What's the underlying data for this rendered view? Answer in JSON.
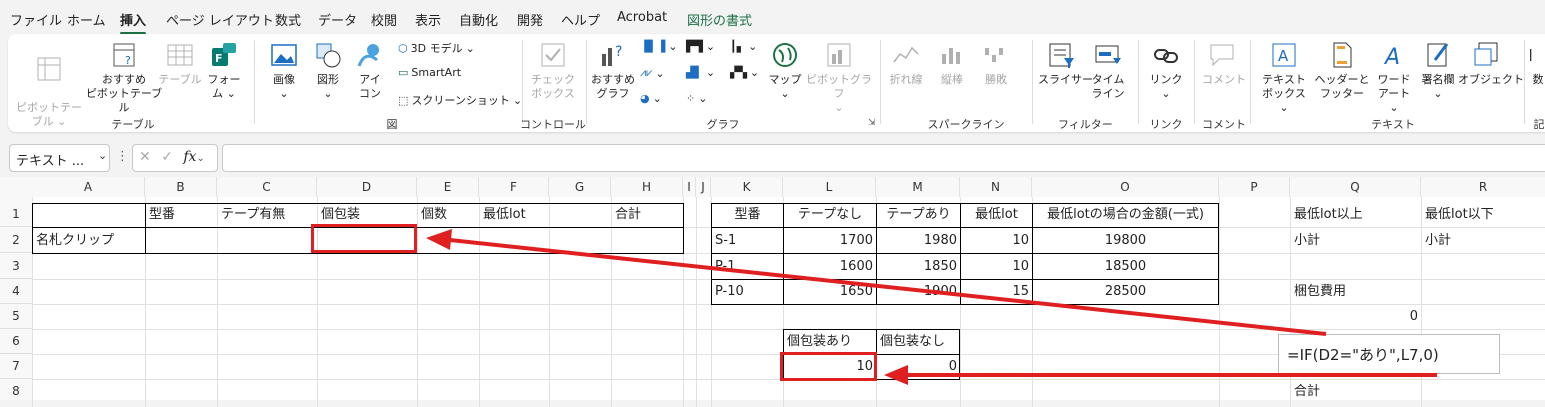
{
  "menu": [
    "ファイル",
    "ホーム",
    "挿入",
    "ページ レイアウト",
    "数式",
    "データ",
    "校閲",
    "表示",
    "自動化",
    "開発",
    "ヘルプ",
    "Acrobat",
    "図形の書式"
  ],
  "ribbon": {
    "pivot_table": "ピボットテー\nブル ⌄",
    "recommended_pivot": "おすすめ\nピボットテーブル",
    "table": "テーブル",
    "forms": "フォー\nム ⌄",
    "group_table": "テーブル",
    "image": "画像\n⌄",
    "shapes": "図形\n⌄",
    "icons": "アイ\nコン",
    "model3d": "3D モデル",
    "smartart": "SmartArt",
    "screenshot": "スクリーンショット",
    "group_figure": "図",
    "checkbox": "チェック\nボックス",
    "group_control": "コントロール",
    "recommended_chart": "おすすめ\nグラフ",
    "map": "マップ\n⌄",
    "pivot_chart": "ピボットグラフ\n⌄",
    "group_chart": "グラフ",
    "line": "折れ線",
    "column": "縦棒",
    "winloss": "勝敗",
    "group_sparkline": "スパークライン",
    "slicer": "スライサー",
    "timeline": "タイム\nライン",
    "group_filter": "フィルター",
    "link": "リンク\n⌄",
    "group_link": "リンク",
    "comment": "コメント",
    "group_comment": "コメント",
    "textbox": "テキスト\nボックス ⌄",
    "header_footer": "ヘッダーと\nフッター",
    "wordart": "ワード\nアート ⌄",
    "signature": "署名欄\n⌄",
    "object": "オブジェクト",
    "group_text": "テキスト",
    "symbol": "数",
    "group_symbol": "記"
  },
  "formula_bar": {
    "name_box": "テキスト ...",
    "fx": "fx",
    "formula": ""
  },
  "columns": [
    "A",
    "B",
    "C",
    "D",
    "E",
    "F",
    "G",
    "H",
    "I",
    "J",
    "K",
    "L",
    "M",
    "N",
    "O",
    "P",
    "Q",
    "R"
  ],
  "rows": [
    "1",
    "2",
    "3",
    "4",
    "5",
    "6",
    "7",
    "8"
  ],
  "cells": {
    "B1": "型番",
    "C1": "テープ有無",
    "D1": "個包装",
    "E1": "個数",
    "F1": "最低lot",
    "H1": "合計",
    "A2": "名札クリップ",
    "K1": "型番",
    "L1": "テープなし",
    "M1": "テープあり",
    "N1": "最低lot",
    "O1": "最低lotの場合の金額(一式)",
    "K2": "S-1",
    "L2": "1700",
    "M2": "1980",
    "N2": "10",
    "O2": "19800",
    "K3": "P-1",
    "L3": "1600",
    "M3": "1850",
    "N3": "10",
    "O3": "18500",
    "K4": "P-10",
    "L4": "1650",
    "M4": "1900",
    "N4": "15",
    "O4": "28500",
    "Q1": "最低lot以上",
    "R1": "最低lot以下",
    "Q2": "小計",
    "R2": "小計",
    "Q4": "梱包費用",
    "Q5": "0",
    "L6": "個包装あり",
    "M6": "個包装なし",
    "L7": "10",
    "M7": "0",
    "Q8": "合計"
  },
  "annotation": {
    "callout_text": "=IF(D2=\"あり\",L7,0)",
    "accent_color": "#e02020"
  }
}
